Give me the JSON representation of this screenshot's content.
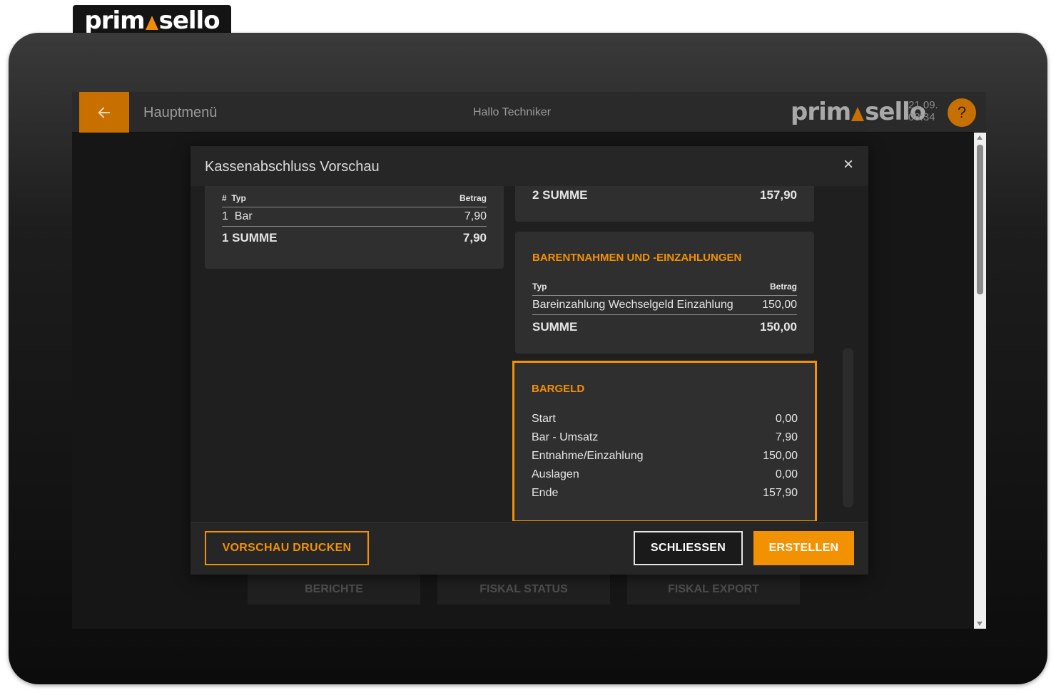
{
  "brand": {
    "logo_left": "prim",
    "logo_right": "sello"
  },
  "topbar": {
    "title": "Hauptmenü",
    "greeting": "Hallo Techniker",
    "date": "21.09.",
    "time": "08:34",
    "help_label": "?"
  },
  "background_buttons": [
    "BERICHTE",
    "FISKAL STATUS",
    "FISKAL EXPORT"
  ],
  "modal": {
    "title": "Kassenabschluss Vorschau",
    "close_label": "×",
    "left_card": {
      "header_num": "#",
      "header_type": "Typ",
      "header_amount": "Betrag",
      "rows": [
        {
          "num": "1",
          "type": "Bar",
          "amount": "7,90"
        }
      ],
      "sum_label": "1 SUMME",
      "sum_value": "7,90"
    },
    "top_right_card": {
      "sum_label": "2 SUMME",
      "sum_value": "157,90"
    },
    "withdrawals_card": {
      "title": "BARENTNAHMEN UND -EINZAHLUNGEN",
      "header_type": "Typ",
      "header_amount": "Betrag",
      "rows": [
        {
          "type": "Bareinzahlung Wechselgeld Einzahlung",
          "amount": "150,00"
        }
      ],
      "sum_label": "SUMME",
      "sum_value": "150,00"
    },
    "cash_card": {
      "title": "BARGELD",
      "rows": [
        {
          "label": "Start",
          "value": "0,00"
        },
        {
          "label": "Bar - Umsatz",
          "value": "7,90"
        },
        {
          "label": "Entnahme/Einzahlung",
          "value": "150,00"
        },
        {
          "label": "Auslagen",
          "value": "0,00"
        },
        {
          "label": "Ende",
          "value": "157,90"
        }
      ]
    },
    "footer": {
      "print_preview": "VORSCHAU DRUCKEN",
      "close": "SCHLIESSEN",
      "create": "ERSTELLEN"
    }
  },
  "colors": {
    "accent": "#f39200",
    "accent_dark": "#c77000",
    "card_bg": "#2f2f2f"
  }
}
